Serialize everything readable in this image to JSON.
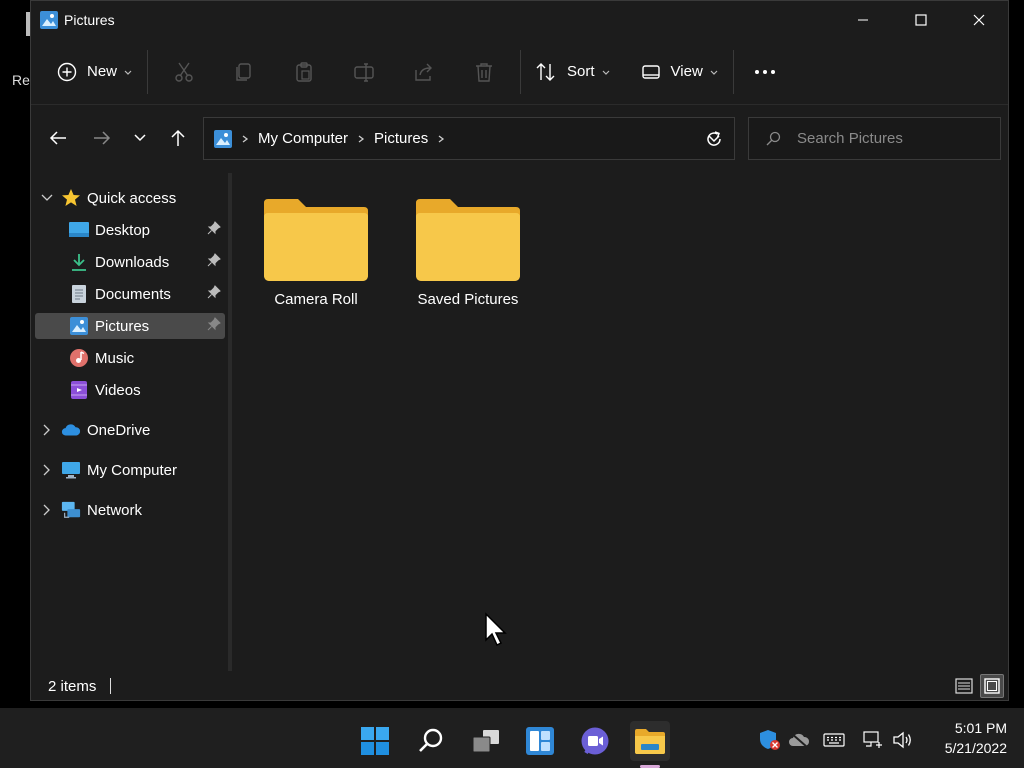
{
  "desktop": {
    "label": "Re"
  },
  "window": {
    "title": "Pictures",
    "controls": [
      "minimize",
      "maximize",
      "close"
    ]
  },
  "commandbar": {
    "new_label": "New",
    "sort_label": "Sort",
    "view_label": "View"
  },
  "address": {
    "crumbs": [
      "My Computer",
      "Pictures"
    ]
  },
  "search": {
    "placeholder": "Search Pictures"
  },
  "sidebar": {
    "quick_access": "Quick access",
    "items": [
      {
        "label": "Desktop",
        "pinned": true
      },
      {
        "label": "Downloads",
        "pinned": true
      },
      {
        "label": "Documents",
        "pinned": true
      },
      {
        "label": "Pictures",
        "pinned": true,
        "selected": true
      },
      {
        "label": "Music",
        "pinned": false
      },
      {
        "label": "Videos",
        "pinned": false
      }
    ],
    "roots": [
      "OneDrive",
      "My Computer",
      "Network"
    ]
  },
  "content": {
    "folders": [
      "Camera Roll",
      "Saved Pictures"
    ]
  },
  "status": {
    "count": "2 items"
  },
  "taskbar": {
    "time": "5:01 PM",
    "date": "5/21/2022"
  },
  "colors": {
    "folder": "#f7c84a",
    "folder_dark": "#e8a92a",
    "accent": "#4aa0e8",
    "selected": "#4a4a4a"
  }
}
